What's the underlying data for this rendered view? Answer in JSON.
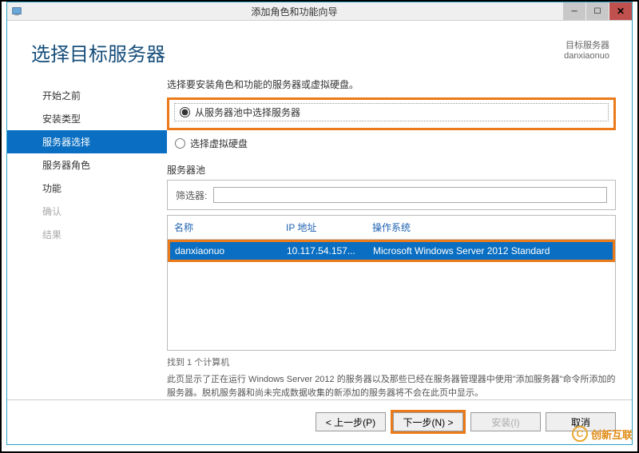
{
  "titlebar": {
    "title": "添加角色和功能向导"
  },
  "header": {
    "title": "选择目标服务器",
    "right_label": "目标服务器",
    "right_value": "danxiaonuo"
  },
  "sidebar": {
    "items": [
      {
        "label": "开始之前",
        "active": false
      },
      {
        "label": "安装类型",
        "active": false
      },
      {
        "label": "服务器选择",
        "active": true
      },
      {
        "label": "服务器角色",
        "active": false
      },
      {
        "label": "功能",
        "active": false
      },
      {
        "label": "确认",
        "disabled": true
      },
      {
        "label": "结果",
        "disabled": true
      }
    ]
  },
  "main": {
    "instruction": "选择要安装角色和功能的服务器或虚拟硬盘。",
    "radio1": "从服务器池中选择服务器",
    "radio2": "选择虚拟硬盘",
    "pool_label": "服务器池",
    "filter_label": "筛选器:",
    "filter_value": "",
    "columns": {
      "name": "名称",
      "ip": "IP 地址",
      "os": "操作系统"
    },
    "row": {
      "name": "danxiaonuo",
      "ip": "10.117.54.157...",
      "os": "Microsoft Windows Server 2012 Standard"
    },
    "count": "找到 1 个计算机",
    "desc": "此页显示了正在运行 Windows Server 2012 的服务器以及那些已经在服务器管理器中使用\"添加服务器\"命令所添加的服务器。脱机服务器和尚未完成数据收集的新添加的服务器将不会在此页中显示。"
  },
  "footer": {
    "prev": "< 上一步(P)",
    "next": "下一步(N) >",
    "install": "安装(I)",
    "cancel": "取消"
  },
  "watermark": "创新互联"
}
